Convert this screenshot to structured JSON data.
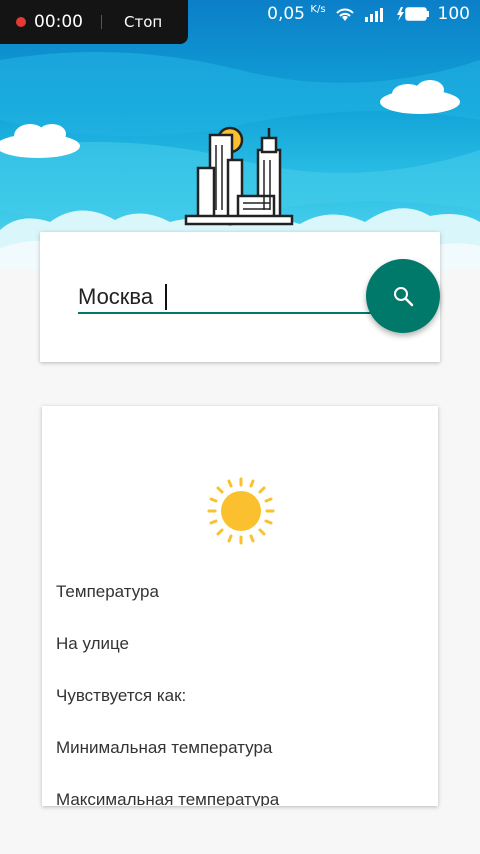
{
  "status_bar": {
    "record_time": "00:00",
    "record_stop": "Стоп",
    "net_speed_value": "0,05",
    "net_speed_unit": "K/s",
    "battery": "100"
  },
  "search": {
    "city_value": "Москва"
  },
  "weather": {
    "rows": [
      "Температура",
      "На улице",
      "Чувствуется как:",
      "Минимальная температура",
      "Максимальная температура"
    ]
  },
  "colors": {
    "accent": "#00796b",
    "sun": "#fbc02d",
    "sky_top": "#0b7fc8"
  }
}
